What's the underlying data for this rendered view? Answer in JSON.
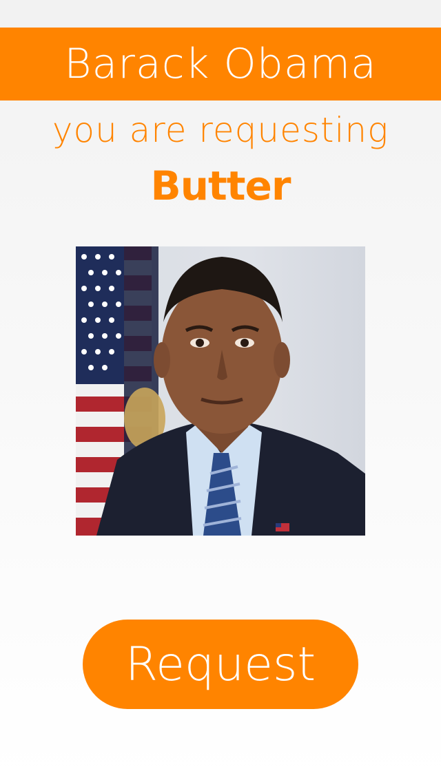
{
  "profile": {
    "name": "Barack Obama"
  },
  "request": {
    "prompt": "you are requesting",
    "item": "Butter"
  },
  "actions": {
    "request_label": "Request"
  },
  "colors": {
    "accent": "#ff8400",
    "text_on_accent": "#ffffff",
    "background": "#f5f5f5"
  }
}
